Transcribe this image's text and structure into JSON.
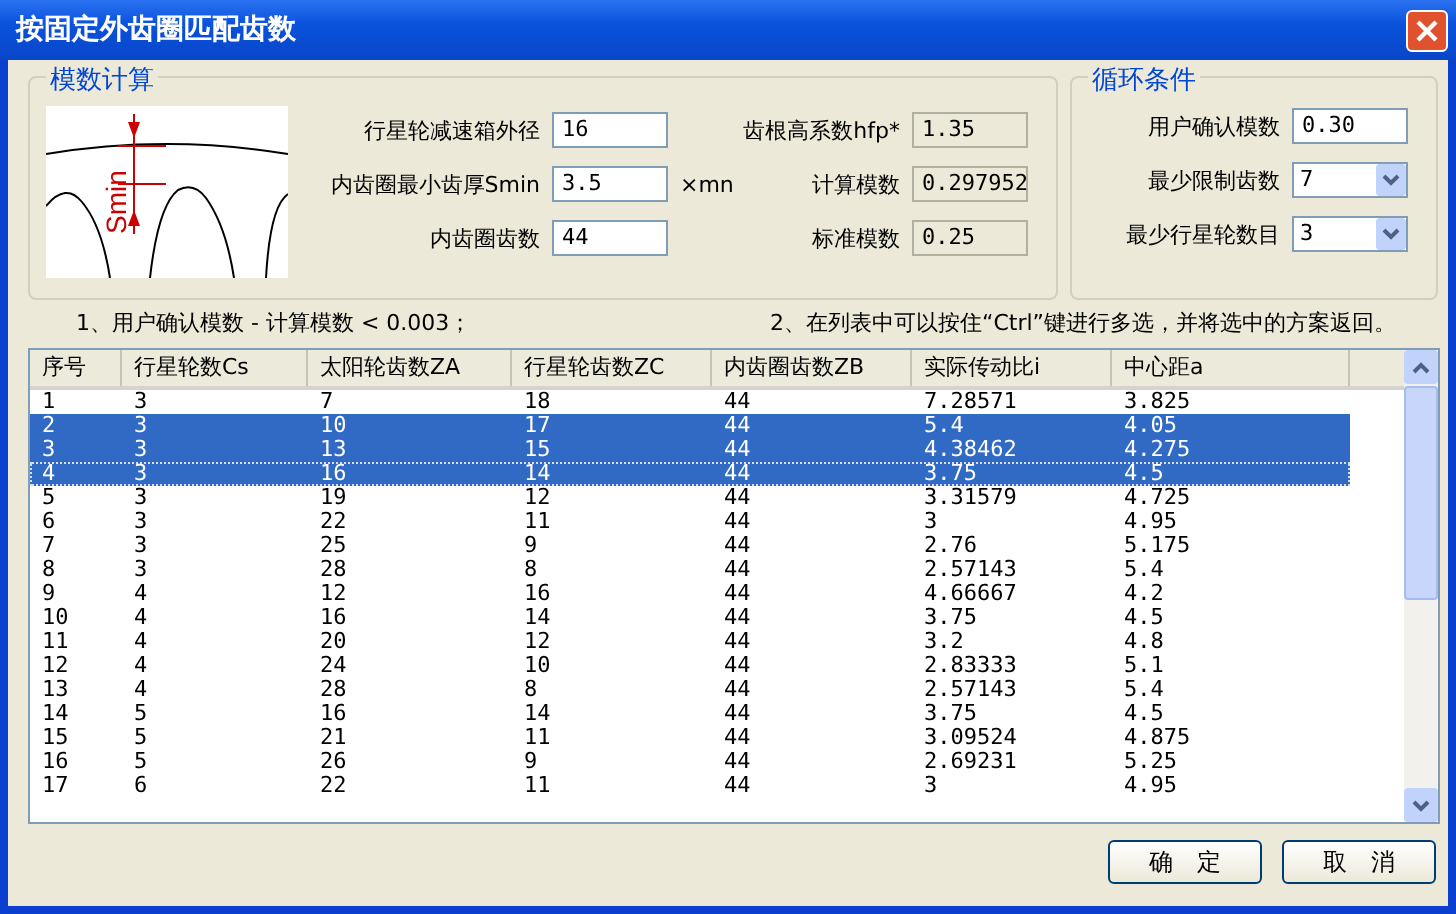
{
  "window": {
    "title": "按固定外齿圈匹配齿数"
  },
  "modulus_group": {
    "title": "模数计算",
    "diagram_label": "Smin",
    "left_fields": [
      {
        "label": "行星轮减速箱外径",
        "value": "16",
        "kind": "input"
      },
      {
        "label": "内齿圈最小齿厚Smin",
        "value": "3.5",
        "kind": "input",
        "unit": "×mn"
      },
      {
        "label": "内齿圈齿数",
        "value": "44",
        "kind": "input"
      }
    ],
    "right_fields": [
      {
        "label": "齿根高系数hfp*",
        "value": "1.35",
        "kind": "readonly"
      },
      {
        "label": "计算模数",
        "value": "0.297952",
        "kind": "readonly"
      },
      {
        "label": "标准模数",
        "value": "0.25",
        "kind": "readonly"
      }
    ]
  },
  "loop_group": {
    "title": "循环条件",
    "fields": [
      {
        "label": "用户确认模数",
        "value": "0.30",
        "kind": "input"
      },
      {
        "label": "最少限制齿数",
        "value": "7",
        "kind": "dropdown"
      },
      {
        "label": "最少行星轮数目",
        "value": "3",
        "kind": "dropdown"
      }
    ]
  },
  "notes": [
    "1、用户确认模数 - 计算模数 < 0.003；",
    "2、在列表中可以按住“Ctrl”键进行多选，并将选中的方案返回。"
  ],
  "table": {
    "columns": [
      "序号",
      "行星轮数Cs",
      "太阳轮齿数ZA",
      "行星轮齿数ZC",
      "内齿圈齿数ZB",
      "实际传动比i",
      "中心距a"
    ],
    "rows": [
      {
        "cells": [
          "1",
          "3",
          "7",
          "18",
          "44",
          "7.28571",
          "3.825"
        ],
        "selected": false,
        "focused": false
      },
      {
        "cells": [
          "2",
          "3",
          "10",
          "17",
          "44",
          "5.4",
          "4.05"
        ],
        "selected": true,
        "focused": false
      },
      {
        "cells": [
          "3",
          "3",
          "13",
          "15",
          "44",
          "4.38462",
          "4.275"
        ],
        "selected": true,
        "focused": false
      },
      {
        "cells": [
          "4",
          "3",
          "16",
          "14",
          "44",
          "3.75",
          "4.5"
        ],
        "selected": true,
        "focused": true
      },
      {
        "cells": [
          "5",
          "3",
          "19",
          "12",
          "44",
          "3.31579",
          "4.725"
        ],
        "selected": false,
        "focused": false
      },
      {
        "cells": [
          "6",
          "3",
          "22",
          "11",
          "44",
          "3",
          "4.95"
        ],
        "selected": false,
        "focused": false
      },
      {
        "cells": [
          "7",
          "3",
          "25",
          "9",
          "44",
          "2.76",
          "5.175"
        ],
        "selected": false,
        "focused": false
      },
      {
        "cells": [
          "8",
          "3",
          "28",
          "8",
          "44",
          "2.57143",
          "5.4"
        ],
        "selected": false,
        "focused": false
      },
      {
        "cells": [
          "9",
          "4",
          "12",
          "16",
          "44",
          "4.66667",
          "4.2"
        ],
        "selected": false,
        "focused": false
      },
      {
        "cells": [
          "10",
          "4",
          "16",
          "14",
          "44",
          "3.75",
          "4.5"
        ],
        "selected": false,
        "focused": false
      },
      {
        "cells": [
          "11",
          "4",
          "20",
          "12",
          "44",
          "3.2",
          "4.8"
        ],
        "selected": false,
        "focused": false
      },
      {
        "cells": [
          "12",
          "4",
          "24",
          "10",
          "44",
          "2.83333",
          "5.1"
        ],
        "selected": false,
        "focused": false
      },
      {
        "cells": [
          "13",
          "4",
          "28",
          "8",
          "44",
          "2.57143",
          "5.4"
        ],
        "selected": false,
        "focused": false
      },
      {
        "cells": [
          "14",
          "5",
          "16",
          "14",
          "44",
          "3.75",
          "4.5"
        ],
        "selected": false,
        "focused": false
      },
      {
        "cells": [
          "15",
          "5",
          "21",
          "11",
          "44",
          "3.09524",
          "4.875"
        ],
        "selected": false,
        "focused": false
      },
      {
        "cells": [
          "16",
          "5",
          "26",
          "9",
          "44",
          "2.69231",
          "5.25"
        ],
        "selected": false,
        "focused": false
      },
      {
        "cells": [
          "17",
          "6",
          "22",
          "11",
          "44",
          "3",
          "4.95"
        ],
        "selected": false,
        "focused": false
      }
    ]
  },
  "buttons": [
    "确　定",
    "取　消"
  ]
}
